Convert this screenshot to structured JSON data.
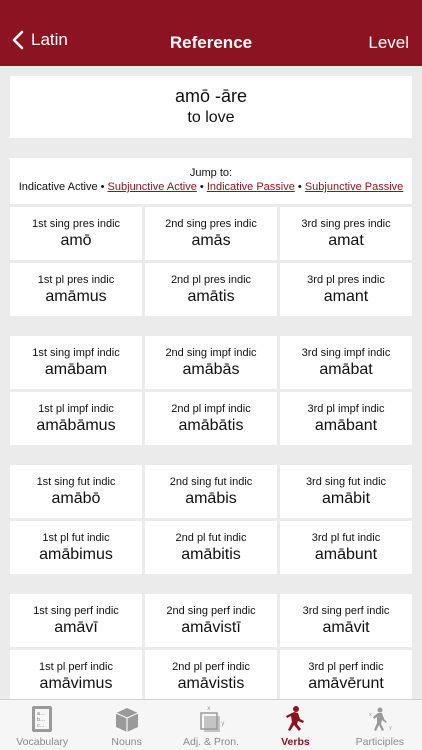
{
  "nav": {
    "back_label": "Latin",
    "title": "Reference",
    "right_label": "Level"
  },
  "verb": {
    "lemma": "amō -āre",
    "meaning": "to love"
  },
  "jump": {
    "label": "Jump to:",
    "current": "Indicative Active",
    "separator": "•",
    "links": [
      "Subjunctive Active",
      "Indicative Passive",
      "Subjunctive Passive"
    ]
  },
  "groups": [
    {
      "cells": [
        {
          "label": "1st sing pres indic",
          "form": "amō"
        },
        {
          "label": "2nd sing pres indic",
          "form": "amās"
        },
        {
          "label": "3rd sing pres indic",
          "form": "amat"
        },
        {
          "label": "1st pl pres indic",
          "form": "amāmus"
        },
        {
          "label": "2nd pl pres indic",
          "form": "amātis"
        },
        {
          "label": "3rd pl pres indic",
          "form": "amant"
        }
      ]
    },
    {
      "cells": [
        {
          "label": "1st sing impf indic",
          "form": "amābam"
        },
        {
          "label": "2nd sing impf indic",
          "form": "amābās"
        },
        {
          "label": "3rd sing impf indic",
          "form": "amābat"
        },
        {
          "label": "1st pl impf indic",
          "form": "amābāmus"
        },
        {
          "label": "2nd pl impf indic",
          "form": "amābātis"
        },
        {
          "label": "3rd pl impf indic",
          "form": "amābant"
        }
      ]
    },
    {
      "cells": [
        {
          "label": "1st sing fut indic",
          "form": "amābō"
        },
        {
          "label": "2nd sing fut indic",
          "form": "amābis"
        },
        {
          "label": "3rd sing fut indic",
          "form": "amābit"
        },
        {
          "label": "1st pl fut indic",
          "form": "amābimus"
        },
        {
          "label": "2nd pl fut indic",
          "form": "amābitis"
        },
        {
          "label": "3rd pl fut indic",
          "form": "amābunt"
        }
      ]
    },
    {
      "cells": [
        {
          "label": "1st sing perf indic",
          "form": "amāvī"
        },
        {
          "label": "2nd sing perf indic",
          "form": "amāvistī"
        },
        {
          "label": "3rd sing perf indic",
          "form": "amāvit"
        },
        {
          "label": "1st pl perf indic",
          "form": "amāvimus"
        },
        {
          "label": "2nd pl perf indic",
          "form": "amāvistis"
        },
        {
          "label": "3rd pl perf indic",
          "form": "amāvērunt"
        }
      ]
    }
  ],
  "tabs": [
    {
      "label": "Vocabulary",
      "icon": "vocabulary-icon",
      "active": false
    },
    {
      "label": "Nouns",
      "icon": "nouns-icon",
      "active": false
    },
    {
      "label": "Adj. & Pron.",
      "icon": "adjectives-icon",
      "active": false
    },
    {
      "label": "Verbs",
      "icon": "verbs-icon",
      "active": true
    },
    {
      "label": "Participles",
      "icon": "participles-icon",
      "active": false
    }
  ],
  "colors": {
    "accent": "#8c1420",
    "background": "#ebebeb",
    "tab_inactive": "#8a8a8a"
  }
}
